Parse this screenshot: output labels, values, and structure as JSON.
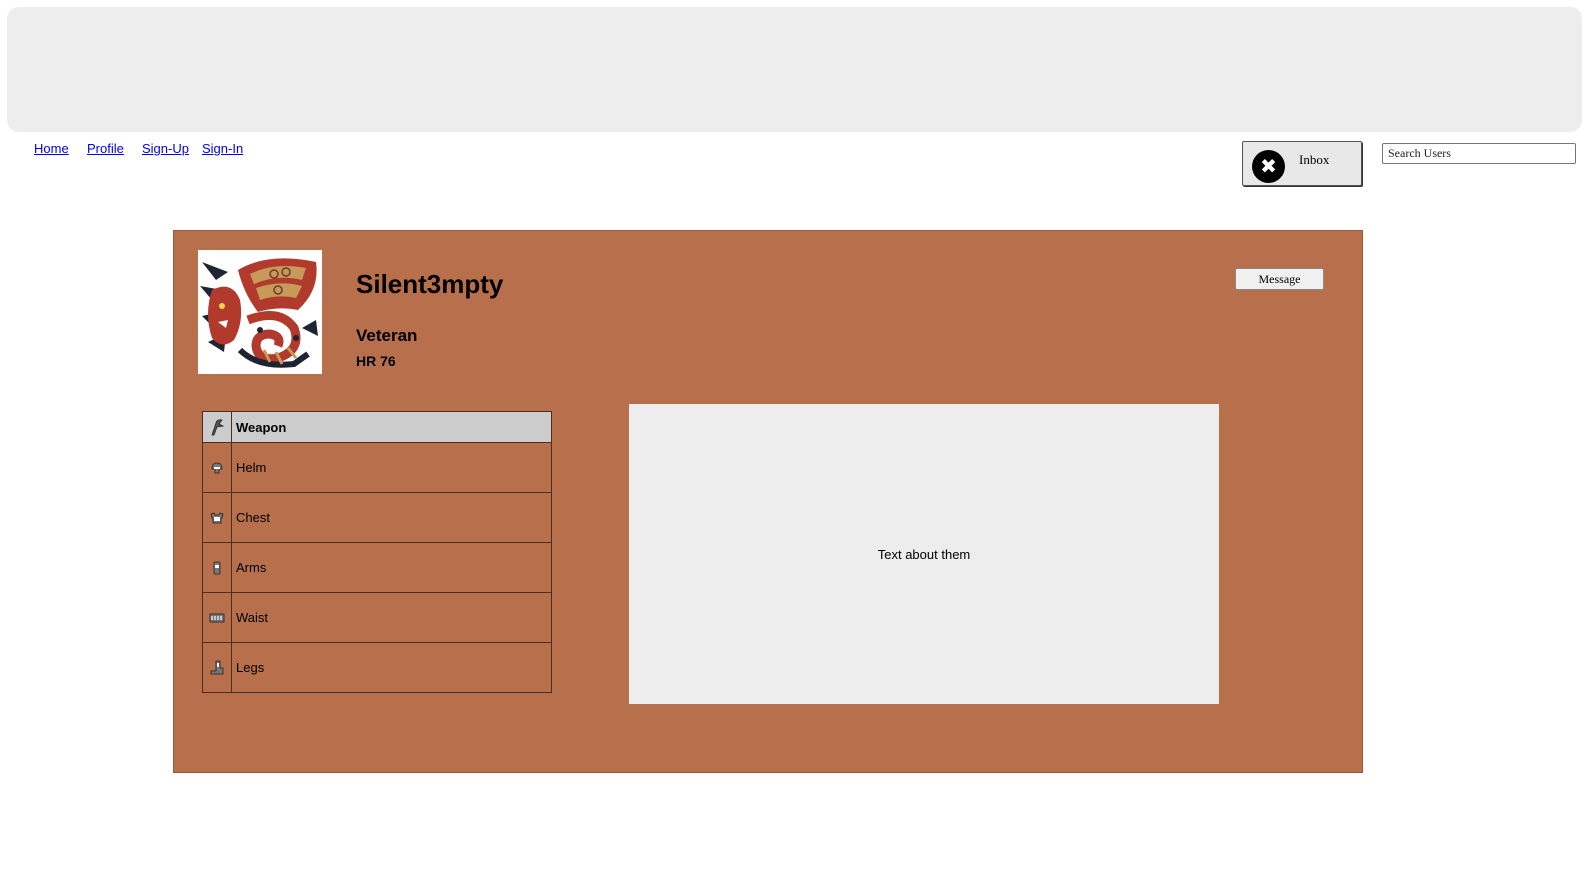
{
  "nav": {
    "links": [
      "Home",
      "Profile",
      "Sign-Up",
      "Sign-In"
    ]
  },
  "inbox": {
    "label": "Inbox",
    "icon": "close-icon"
  },
  "search": {
    "placeholder": "Search Users"
  },
  "profile": {
    "username": "Silent3mpty",
    "rank": "Veteran",
    "hunter_rank": "HR 76",
    "message_button": "Message",
    "about": "Text about them",
    "avatar_icon": "monster-crest-icon"
  },
  "gear": [
    {
      "label": "Weapon",
      "icon": "weapon-icon"
    },
    {
      "label": "Helm",
      "icon": "helm-icon"
    },
    {
      "label": "Chest",
      "icon": "chest-icon"
    },
    {
      "label": "Arms",
      "icon": "arms-icon"
    },
    {
      "label": "Waist",
      "icon": "waist-icon"
    },
    {
      "label": "Legs",
      "icon": "legs-icon"
    }
  ],
  "colors": {
    "card_background": "#b8704c",
    "banner_background": "#ededed",
    "link": "#0000ee",
    "table_header": "#cccccc"
  }
}
